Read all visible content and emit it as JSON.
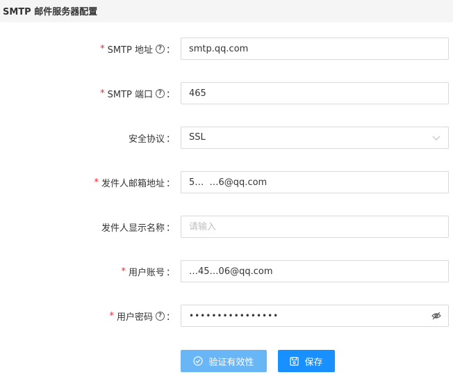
{
  "header": {
    "title": "SMTP 邮件服务器配置"
  },
  "form": {
    "smtp_host": {
      "label": "SMTP 地址",
      "value": "smtp.qq.com",
      "required": "*"
    },
    "smtp_port": {
      "label": "SMTP 端口",
      "value": "465",
      "required": "*"
    },
    "security": {
      "label": "安全协议",
      "selected": "SSL"
    },
    "sender_email": {
      "label": "发件人邮箱地址",
      "value": "5…  …6@qq.com",
      "required": "*"
    },
    "sender_name": {
      "label": "发件人显示名称",
      "placeholder": "请输入"
    },
    "username": {
      "label": "用户账号",
      "value": "…45…06@qq.com",
      "required": "*"
    },
    "password": {
      "label": "用户密码",
      "value": "••••••••••••••••",
      "required": "*"
    }
  },
  "colon": "：",
  "help_glyph": "?",
  "buttons": {
    "validate": {
      "label": "验证有效性",
      "icon": "check-circle-icon"
    },
    "save": {
      "label": "保存",
      "icon": "save-icon"
    }
  },
  "colors": {
    "required": "#f5222d",
    "primary": "#1890ff",
    "primary_light": "#69b6f7",
    "header_bg": "#f5f5f5"
  }
}
